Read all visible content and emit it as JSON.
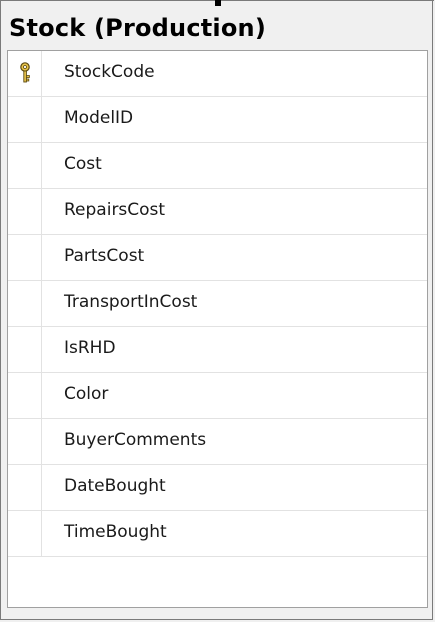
{
  "window": {
    "title": "Stock (Production)"
  },
  "columns": [
    {
      "name": "StockCode",
      "icon": "key-icon"
    },
    {
      "name": "ModelID",
      "icon": ""
    },
    {
      "name": "Cost",
      "icon": ""
    },
    {
      "name": "RepairsCost",
      "icon": ""
    },
    {
      "name": "PartsCost",
      "icon": ""
    },
    {
      "name": "TransportInCost",
      "icon": ""
    },
    {
      "name": "IsRHD",
      "icon": ""
    },
    {
      "name": "Color",
      "icon": ""
    },
    {
      "name": "BuyerComments",
      "icon": ""
    },
    {
      "name": "DateBought",
      "icon": ""
    },
    {
      "name": "TimeBought",
      "icon": ""
    }
  ],
  "colors": {
    "background": "#f0f0f0",
    "grid": "#ffffff",
    "gridline": "#e2e2e2",
    "key": "#c9a227"
  }
}
